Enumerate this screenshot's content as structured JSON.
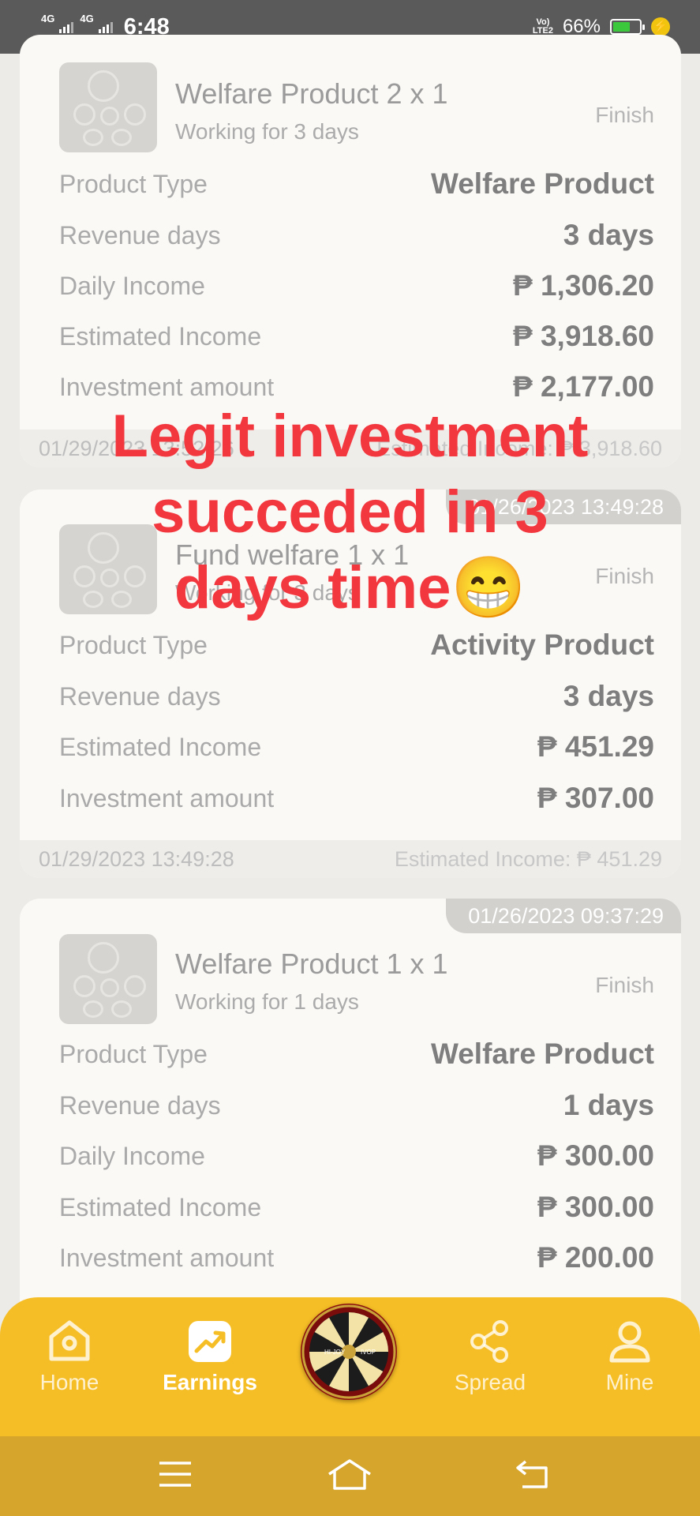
{
  "status_bar": {
    "sim1": "4G",
    "sim2": "4G",
    "time": "6:48",
    "volte_top": "Vo)",
    "volte_bottom": "LTE2",
    "battery_percent": "66%",
    "battery_level": 0.66
  },
  "cards": [
    {
      "date": "",
      "title": "Welfare Product 2 x 1",
      "subtitle": "Working for 3 days",
      "status": "Finish",
      "rows": [
        {
          "label": "Product Type",
          "value": "Welfare Product"
        },
        {
          "label": "Revenue days",
          "value": "3 days"
        },
        {
          "label": "Daily Income",
          "value": "₱ 1,306.20"
        },
        {
          "label": "Estimated Income",
          "value": "₱ 3,918.60"
        },
        {
          "label": "Investment amount",
          "value": "₱ 2,177.00"
        }
      ],
      "footer_date": "01/29/2023 13:52:26",
      "footer_estimate": "Estimated Income: ₱ 3,918.60"
    },
    {
      "date": "01/26/2023 13:49:28",
      "title": "Fund welfare 1 x 1",
      "subtitle": "Working for 3 days",
      "status": "Finish",
      "rows": [
        {
          "label": "Product Type",
          "value": "Activity Product"
        },
        {
          "label": "Revenue days",
          "value": "3 days"
        },
        {
          "label": "Estimated Income",
          "value": "₱ 451.29"
        },
        {
          "label": "Investment amount",
          "value": "₱ 307.00"
        }
      ],
      "footer_date": "01/29/2023 13:49:28",
      "footer_estimate": "Estimated Income: ₱ 451.29"
    },
    {
      "date": "01/26/2023 09:37:29",
      "title": "Welfare Product 1 x 1",
      "subtitle": "Working for 1 days",
      "status": "Finish",
      "rows": [
        {
          "label": "Product Type",
          "value": "Welfare Product"
        },
        {
          "label": "Revenue days",
          "value": "1 days"
        },
        {
          "label": "Daily Income",
          "value": "₱ 300.00"
        },
        {
          "label": "Estimated Income",
          "value": "₱ 300.00"
        },
        {
          "label": "Investment amount",
          "value": "₱ 200.00"
        }
      ]
    }
  ],
  "overlay_caption": {
    "line1": "Legit investment",
    "line2": "succeded in 3",
    "line3": "days time😁"
  },
  "tabs": [
    {
      "label": "Home",
      "icon": "home-icon"
    },
    {
      "label": "Earnings",
      "icon": "trending-up-icon",
      "active": true
    },
    {
      "label": "",
      "icon": "spin-wheel-icon"
    },
    {
      "label": "Spread",
      "icon": "share-icon"
    },
    {
      "label": "Mine",
      "icon": "user-icon"
    }
  ],
  "wheel_labels": [
    "HI-JOY",
    "IVOP"
  ],
  "system_nav": [
    "menu-icon",
    "home-icon",
    "back-icon"
  ],
  "colors": {
    "tab_bar": "#F6BE26",
    "nav_bar": "#D5A52C",
    "caption": "#F3373E",
    "status_bar": "#5A5A5A",
    "battery": "#3CC83C"
  }
}
